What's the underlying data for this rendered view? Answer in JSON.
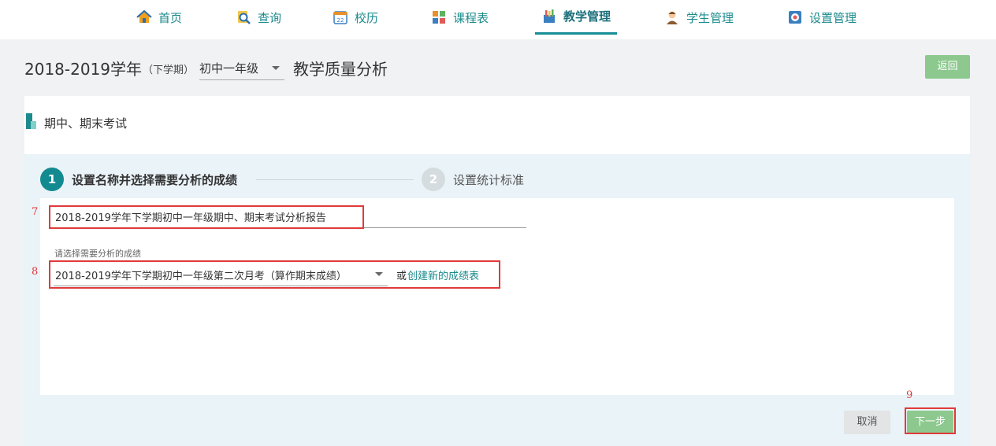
{
  "nav": {
    "items": [
      {
        "label": "首页",
        "icon": "home-icon"
      },
      {
        "label": "查询",
        "icon": "search-icon"
      },
      {
        "label": "校历",
        "icon": "calendar-icon"
      },
      {
        "label": "课程表",
        "icon": "timetable-icon"
      },
      {
        "label": "教学管理",
        "icon": "teaching-icon",
        "active": true
      },
      {
        "label": "学生管理",
        "icon": "student-icon"
      },
      {
        "label": "设置管理",
        "icon": "settings-icon"
      }
    ]
  },
  "header": {
    "year": "2018-2019学年",
    "term": "（下学期）",
    "grade": "初中一年级",
    "title": "教学质量分析",
    "back_label": "返回"
  },
  "card": {
    "title": "期中、期末考试",
    "steps": [
      {
        "number": "1",
        "label": "设置名称并选择需要分析的成绩"
      },
      {
        "number": "2",
        "label": "设置统计标准"
      }
    ],
    "name_value": "2018-2019学年下学期初中一年级期中、期末考试分析报告",
    "select_label": "请选择需要分析的成绩",
    "select_value": "2018-2019学年下学期初中一年级第二次月考（算作期末成绩）",
    "or_text": "或",
    "create_link": "创建新的成绩表",
    "cancel_label": "取消",
    "next_label": "下一步"
  },
  "annotations": {
    "m7": "7",
    "m8": "8",
    "m9": "9"
  },
  "colors": {
    "accent": "#1b8a8c",
    "button_green": "#8dc98f",
    "highlight": "#e03a3a"
  }
}
